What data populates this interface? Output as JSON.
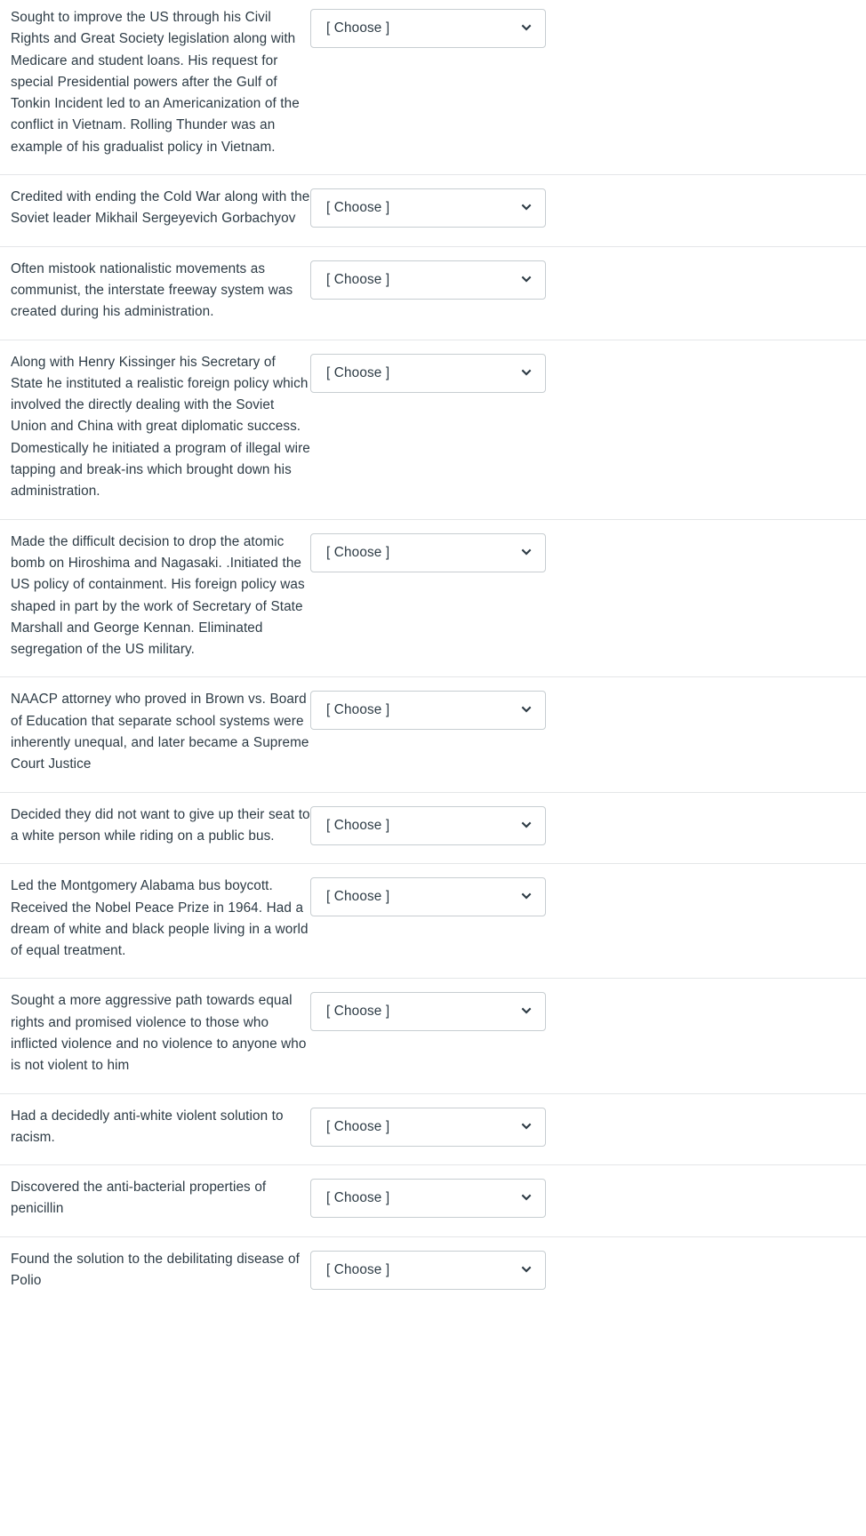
{
  "widget": {
    "type": "matching-question",
    "select_placeholder": "[ Choose ]",
    "chevron_icon": "chevron-down-icon",
    "colors": {
      "text": "#2d3b45",
      "select_border": "#c7cdd1",
      "row_divider": "#e4e6e8",
      "background": "#ffffff",
      "chevron": "#2d3b45"
    }
  },
  "rows": [
    {
      "prompt": "Sought to improve the US through his Civil Rights and Great Society legislation along with Medicare and student loans. His request for special Presidential powers after the Gulf of Tonkin Incident led to an Americanization of the conflict in Vietnam. Rolling Thunder was an example of his gradualist policy in Vietnam.",
      "answer": "[ Choose ]"
    },
    {
      "prompt": "Credited with ending the Cold War along with the Soviet leader Mikhail Sergeyevich Gorbachyov",
      "answer": "[ Choose ]"
    },
    {
      "prompt": "Often mistook nationalistic movements as communist, the interstate freeway system was created during his administration.",
      "answer": "[ Choose ]"
    },
    {
      "prompt": "Along with Henry Kissinger his Secretary of State he instituted a realistic foreign policy which involved the directly dealing with the Soviet Union and China with great diplomatic success. Domestically he initiated a program of illegal wire tapping and break-ins which brought down his administration.",
      "answer": "[ Choose ]"
    },
    {
      "prompt": "Made the difficult decision to drop the atomic bomb on Hiroshima and Nagasaki. .Initiated the US policy of containment. His foreign policy was shaped in part by the work of Secretary of State Marshall and George Kennan. Eliminated segregation of the US military.",
      "answer": "[ Choose ]"
    },
    {
      "prompt": "NAACP attorney who proved in Brown vs. Board of Education that separate school systems were inherently unequal, and later became a Supreme Court Justice",
      "answer": "[ Choose ]"
    },
    {
      "prompt": "Decided they did not want to give up their seat to a white person while riding on a public bus.",
      "answer": "[ Choose ]"
    },
    {
      "prompt": "Led the Montgomery Alabama bus boycott. Received the Nobel Peace Prize in 1964. Had a dream of white and black people living in a world of equal treatment.",
      "answer": "[ Choose ]"
    },
    {
      "prompt": "Sought a more aggressive path towards equal rights and promised violence to those who inflicted violence and no violence to anyone who is not violent to him",
      "answer": "[ Choose ]"
    },
    {
      "prompt": "Had a decidedly anti-white violent solution to racism.",
      "answer": "[ Choose ]"
    },
    {
      "prompt": "Discovered the anti-bacterial properties of penicillin",
      "answer": "[ Choose ]"
    },
    {
      "prompt": "Found the solution to the debilitating disease of Polio",
      "answer": "[ Choose ]"
    }
  ]
}
